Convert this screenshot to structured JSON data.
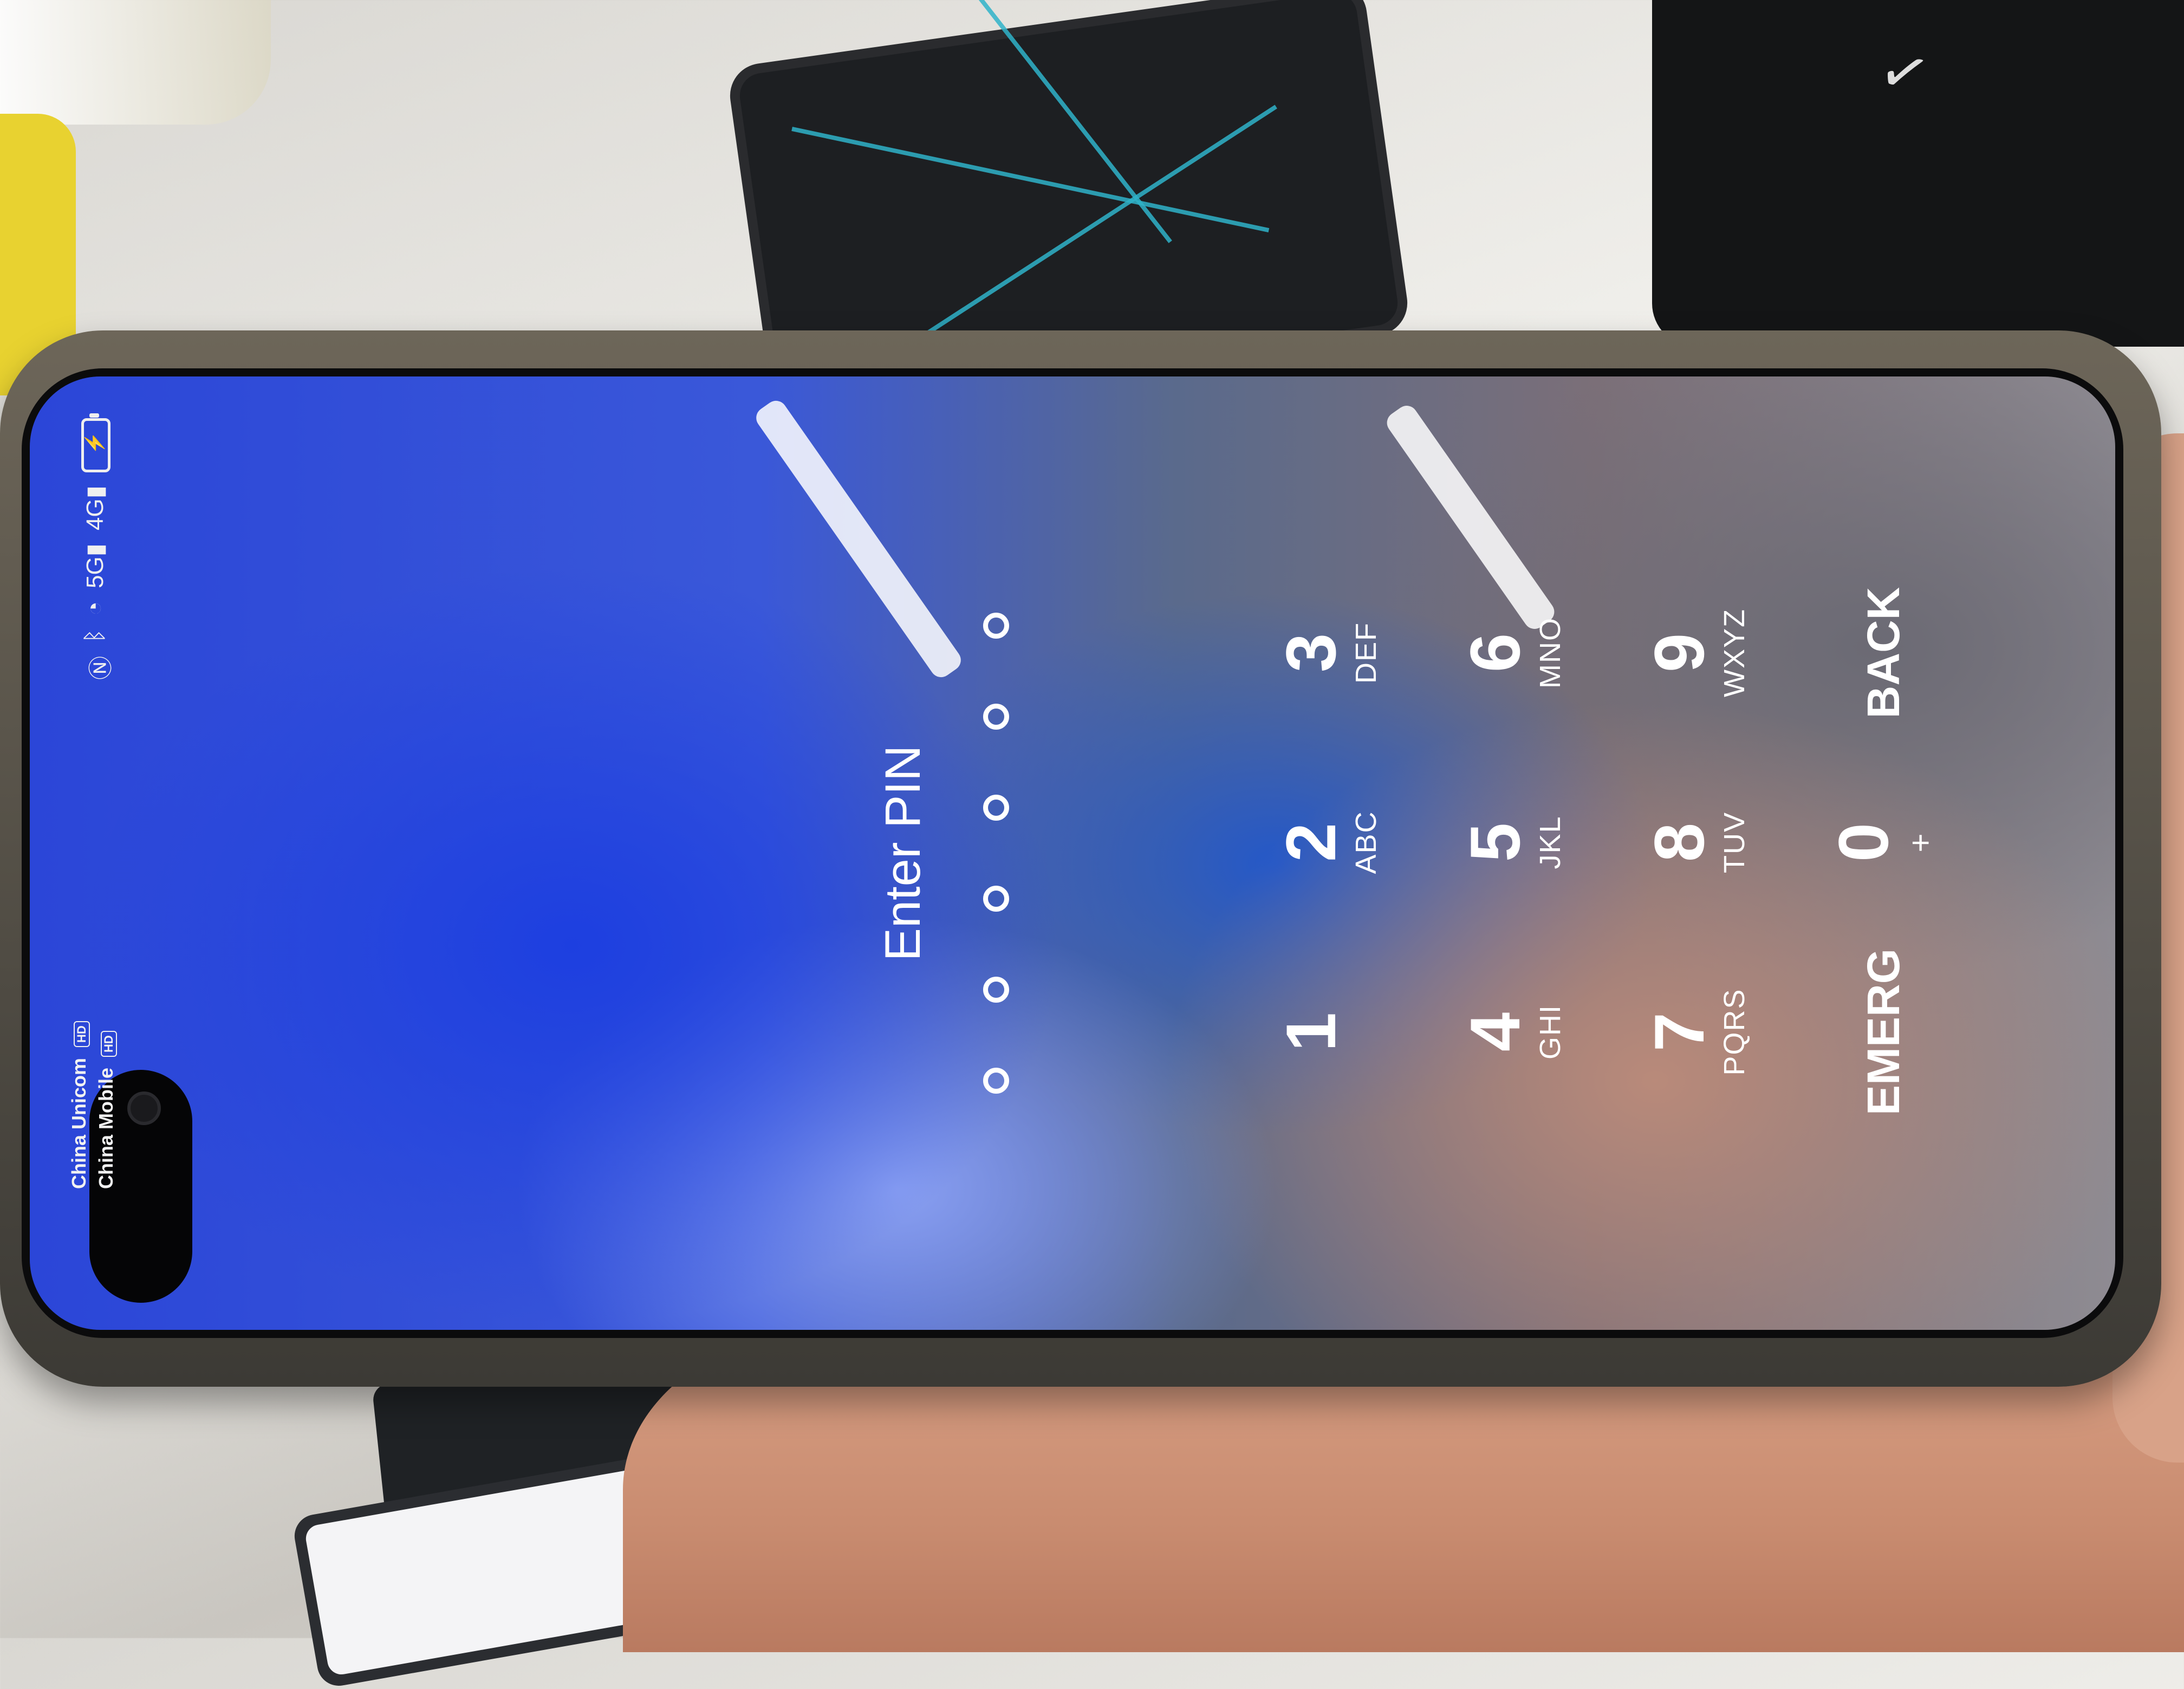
{
  "status_bar": {
    "carriers": [
      {
        "name": "China Unicom",
        "tag": "HD"
      },
      {
        "name": "China Mobile",
        "tag": "HD"
      }
    ],
    "icons": [
      "nfc-icon",
      "bluetooth-icon",
      "wifi-icon",
      "signal-5g-icon",
      "signal-4g-icon",
      "battery-charging-icon"
    ],
    "signal_1_label": "5G",
    "signal_2_label": "4G"
  },
  "lock_screen": {
    "title": "Enter PIN",
    "pin_length": 6,
    "keys": [
      [
        {
          "num": "1",
          "letters": ""
        },
        {
          "num": "2",
          "letters": "ABC"
        },
        {
          "num": "3",
          "letters": "DEF"
        }
      ],
      [
        {
          "num": "4",
          "letters": "GHI"
        },
        {
          "num": "5",
          "letters": "JKL"
        },
        {
          "num": "6",
          "letters": "MNO"
        }
      ],
      [
        {
          "num": "7",
          "letters": "PQRS"
        },
        {
          "num": "8",
          "letters": "TUV"
        },
        {
          "num": "9",
          "letters": "WXYZ"
        }
      ],
      [
        {
          "num": "EMERG",
          "letters": ""
        },
        {
          "num": "0",
          "letters": "+"
        },
        {
          "num": "BACK",
          "letters": ""
        }
      ]
    ]
  },
  "colors": {
    "wallpaper_blue": "#1d3fe0",
    "wallpaper_warm": "#b98a7a",
    "text": "#ffffff"
  }
}
